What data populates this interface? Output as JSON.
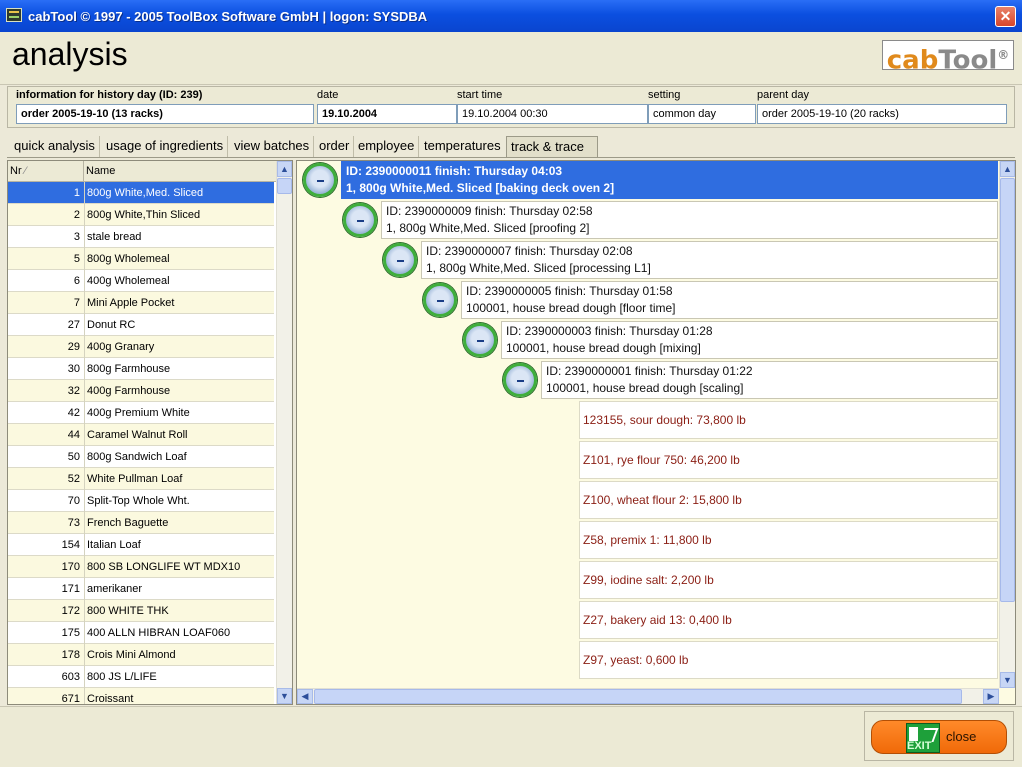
{
  "window": {
    "title": "cabTool © 1997 - 2005 ToolBox Software GmbH  |  logon: SYSDBA",
    "close_glyph": "✕"
  },
  "header": {
    "page_title": "analysis",
    "logo_part1": "cab",
    "logo_part2": "Tool",
    "logo_mark": "®"
  },
  "info": {
    "heading": "information for history day (ID: 239)",
    "order_value": "order 2005-19-10  (13 racks)",
    "date_label": "date",
    "date_value": "19.10.2004",
    "start_label": "start time",
    "start_value": "19.10.2004      00:30",
    "setting_label": "setting",
    "setting_value": "common day",
    "parent_label": "parent day",
    "parent_value": "order 2005-19-10  (20 racks)"
  },
  "tabs": [
    {
      "label": "quick analysis"
    },
    {
      "label": "usage of ingredients"
    },
    {
      "label": "view batches"
    },
    {
      "label": "order"
    },
    {
      "label": "employee"
    },
    {
      "label": "temperatures"
    },
    {
      "label": "track & trace"
    }
  ],
  "active_tab": "track & trace",
  "list": {
    "col_nr": "Nr",
    "sort_glyph": "⁄",
    "col_name": "Name",
    "rows": [
      {
        "nr": "1",
        "name": "800g White,Med. Sliced"
      },
      {
        "nr": "2",
        "name": "800g White,Thin Sliced"
      },
      {
        "nr": "3",
        "name": "stale bread"
      },
      {
        "nr": "5",
        "name": "800g Wholemeal"
      },
      {
        "nr": "6",
        "name": "400g Wholemeal"
      },
      {
        "nr": "7",
        "name": "Mini Apple Pocket"
      },
      {
        "nr": "27",
        "name": "Donut RC"
      },
      {
        "nr": "29",
        "name": "400g Granary"
      },
      {
        "nr": "30",
        "name": "800g Farmhouse"
      },
      {
        "nr": "32",
        "name": "400g Farmhouse"
      },
      {
        "nr": "42",
        "name": "400g Premium White"
      },
      {
        "nr": "44",
        "name": "Caramel Walnut Roll"
      },
      {
        "nr": "50",
        "name": "800g Sandwich Loaf"
      },
      {
        "nr": "52",
        "name": "White Pullman Loaf"
      },
      {
        "nr": "70",
        "name": "Split-Top Whole Wht."
      },
      {
        "nr": "73",
        "name": "French Baguette"
      },
      {
        "nr": "154",
        "name": "Italian Loaf"
      },
      {
        "nr": "170",
        "name": "800 SB LONGLIFE WT MDX10"
      },
      {
        "nr": "171",
        "name": "amerikaner"
      },
      {
        "nr": "172",
        "name": "800 WHITE THK"
      },
      {
        "nr": "175",
        "name": "400 ALLN  HIBRAN LOAF060"
      },
      {
        "nr": "178",
        "name": "Crois Mini Almond"
      },
      {
        "nr": "603",
        "name": "800 JS L/LIFE"
      },
      {
        "nr": "671",
        "name": "Croissant"
      }
    ]
  },
  "tree": {
    "nodes": [
      {
        "line1": "ID: 2390000011   finish: Thursday  04:03",
        "line2": "1, 800g White,Med. Sliced [baking deck oven 2]",
        "toggle_glyph": "–"
      },
      {
        "line1": "ID: 2390000009   finish: Thursday  02:58",
        "line2": "1, 800g White,Med. Sliced [proofing 2]",
        "toggle_glyph": "–"
      },
      {
        "line1": "ID: 2390000007   finish: Thursday  02:08",
        "line2": "1, 800g White,Med. Sliced [processing L1]",
        "toggle_glyph": "–"
      },
      {
        "line1": "ID: 2390000005   finish: Thursday  01:58",
        "line2": "100001, house bread dough [floor time]",
        "toggle_glyph": "–"
      },
      {
        "line1": "ID: 2390000003   finish: Thursday  01:28",
        "line2": "100001, house bread dough [mixing]",
        "toggle_glyph": "–"
      },
      {
        "line1": "ID: 2390000001   finish: Thursday  01:22",
        "line2": "100001, house bread dough [scaling]",
        "toggle_glyph": "–"
      }
    ],
    "ingredients": [
      "123155, sour dough: 73,800 lb",
      "Z101, rye flour 750: 46,200 lb",
      "Z100, wheat flour 2: 15,800 lb",
      "Z58, premix 1: 11,800 lb",
      "Z99, iodine salt: 2,200 lb",
      "Z27, bakery aid 13: 0,400 lb",
      "Z97, yeast: 0,600 lb"
    ]
  },
  "scroll_glyphs": {
    "up": "▲",
    "down": "▼",
    "left": "◀",
    "right": "▶"
  },
  "footer": {
    "close_label": "close",
    "exit_icon_text": "EXIT"
  },
  "colors": {
    "titlebar": "#0b4fe0",
    "selection": "#2f6de0",
    "ingredient_text": "#8b1e14",
    "close_button": "#f06a08",
    "logo_orange": "#e08a1c"
  }
}
